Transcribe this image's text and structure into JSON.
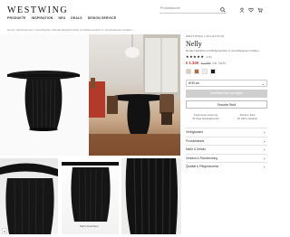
{
  "header": {
    "logo": "WESTWING",
    "search_placeholder": "Produktsuche",
    "nav": [
      "PRODUKTE",
      "INSPIRATION",
      "NEU",
      "DEALS",
      "DESIGN SERVICE"
    ]
  },
  "breadcrumb": "Home / Wohnzimmer / Couchtische / Runder Esstisch Nelly mit Riefenstruktur in verschiedenen Größen",
  "product": {
    "brand": "WESTWING COLLECTION",
    "title": "Nelly",
    "subtitle": "Runder Esstisch mit Riefenstruktur in verschiedenen Größen",
    "stars": "★★★★★",
    "review_count": "(48)",
    "price": "€ 1.349",
    "price_old": "€ 1.599",
    "price_vat": "inkl. MwSt.",
    "swatch_colors": [
      "#d9cbb5",
      "#b36a3a",
      "#f1efec",
      "#1a1a1a"
    ],
    "size_select": "Ø 90 cm",
    "cta_label": "Sofortkauf nicht verfügbar",
    "wishlist_label": "Einsame Wahl",
    "usps": [
      [
        "Kostenlose Lieferung",
        "30 Tage Rückgaberecht"
      ],
      [
        "Sicherer Kauf",
        "30 Jahre Garantie"
      ]
    ],
    "accordion": [
      "Verfügbarkeit",
      "Produktdetails",
      "Maße & Details",
      "Versand & Rücksendung",
      "Qualität & Pflegehinweise"
    ]
  },
  "gallery": {
    "caption": "Mehr Ansichten",
    "counter": "3"
  }
}
